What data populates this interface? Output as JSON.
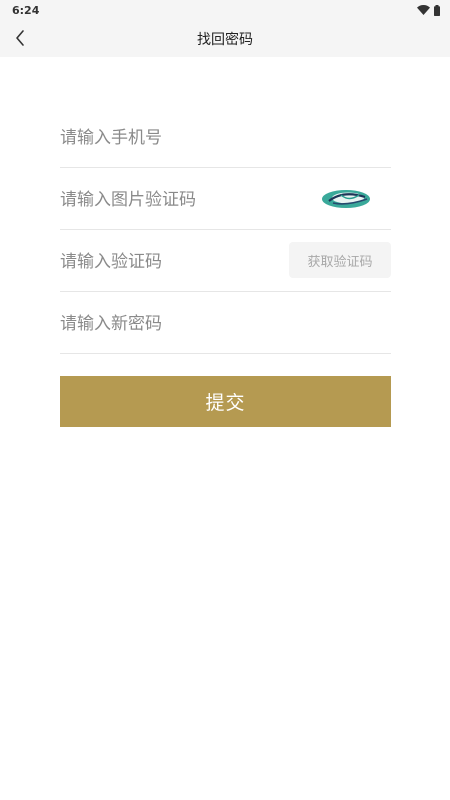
{
  "status_bar": {
    "time": "6:24",
    "icons": [
      "wifi-icon",
      "battery-icon"
    ]
  },
  "nav": {
    "title": "找回密码",
    "back_icon": "chevron-left-icon"
  },
  "form": {
    "phone": {
      "value": "",
      "placeholder": "请输入手机号"
    },
    "image_captcha": {
      "value": "",
      "placeholder": "请输入图片验证码"
    },
    "sms_code": {
      "value": "",
      "placeholder": "请输入验证码",
      "button_label": "获取验证码"
    },
    "new_password": {
      "value": "",
      "placeholder": "请输入新密码"
    }
  },
  "submit": {
    "label": "提交"
  },
  "colors": {
    "accent": "#b59a51",
    "bar_bg": "#f5f5f5",
    "captcha_teal": "#2a9d8f",
    "captcha_navy": "#1d3557"
  }
}
